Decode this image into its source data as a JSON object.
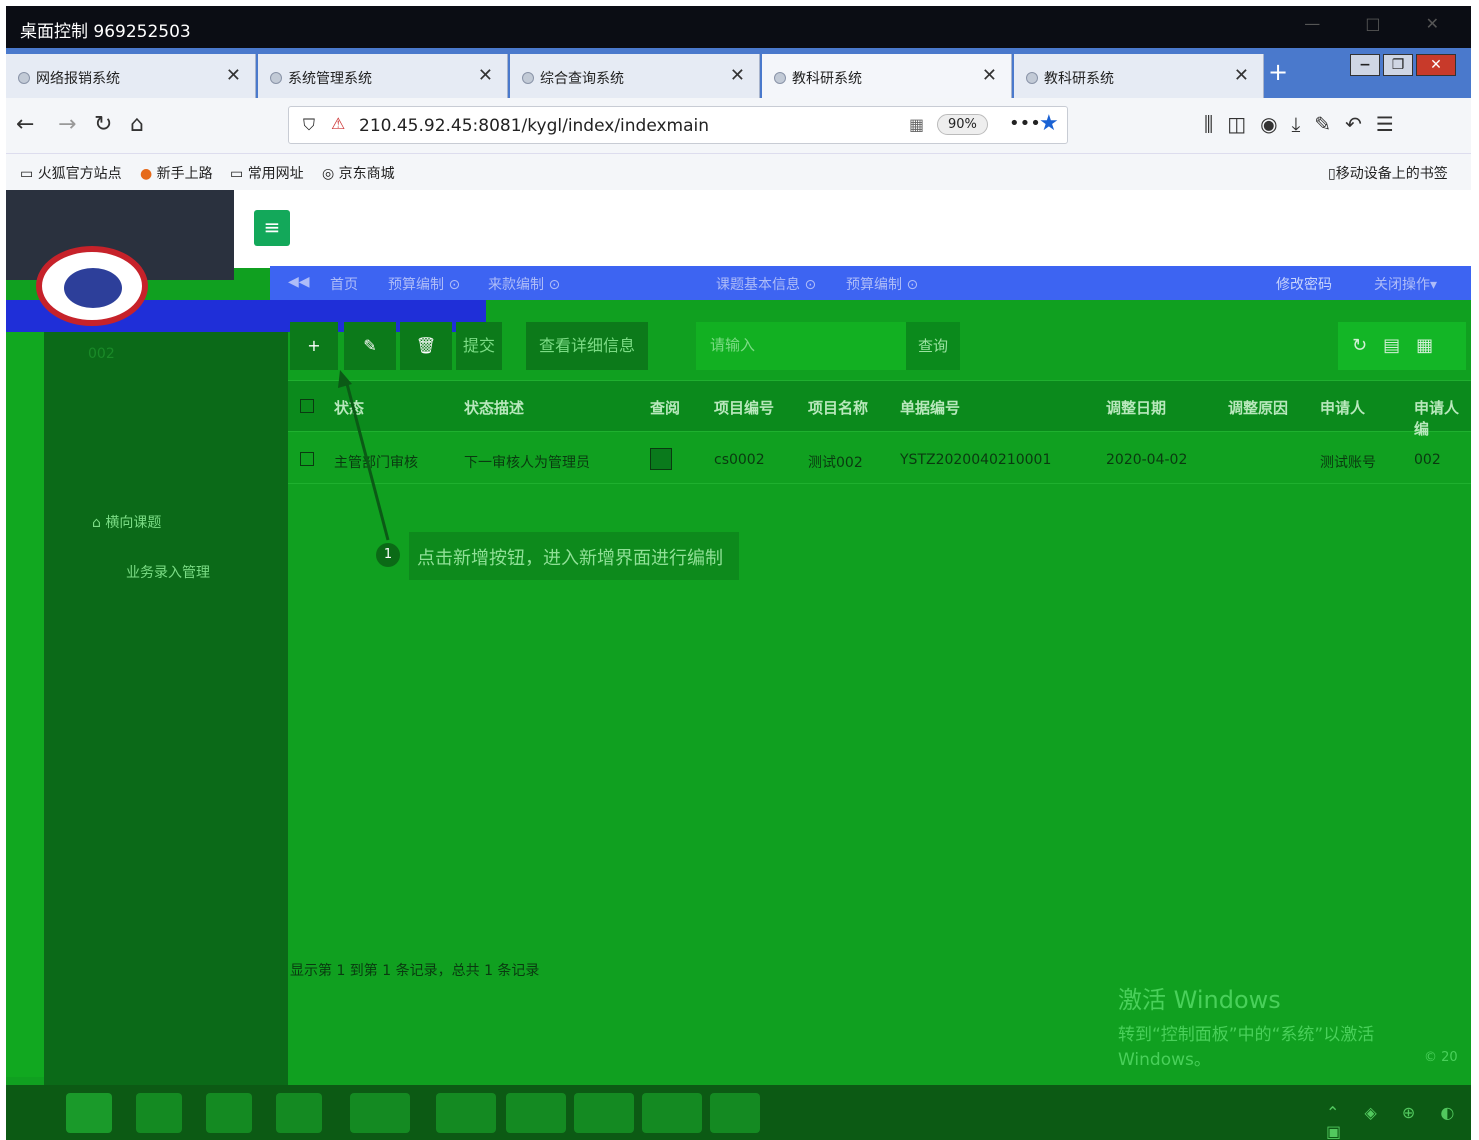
{
  "remote_title": "桌面控制 969252503",
  "tabs": [
    {
      "label": "网络报销系统",
      "active": false
    },
    {
      "label": "系统管理系统",
      "active": false
    },
    {
      "label": "综合查询系统",
      "active": false
    },
    {
      "label": "教科研系统",
      "active": true
    },
    {
      "label": "教科研系统",
      "active": false
    }
  ],
  "url": "210.45.92.45:8081/kygl/index/indexmain",
  "zoom": "90%",
  "bookmarks": [
    "火狐官方站点",
    "新手上路",
    "常用网址",
    "京东商城"
  ],
  "mobile_bookmarks": "移动设备上的书签",
  "page_tabs": [
    "首页",
    "预算编制",
    "来款编制",
    "课题基本信息",
    "预算编制"
  ],
  "change_password": "修改密码",
  "close_ops": "关闭操作",
  "sidebar": {
    "user": "002",
    "section": "横向课题",
    "sub": "业务录入管理"
  },
  "toolbar": {
    "submit": "提交",
    "details": "查看详细信息",
    "search_placeholder": "请输入",
    "query": "查询"
  },
  "table": {
    "headers": [
      "状态",
      "状态描述",
      "查阅",
      "项目编号",
      "项目名称",
      "单据编号",
      "调整日期",
      "调整原因",
      "申请人",
      "申请人编"
    ],
    "rows": [
      {
        "status": "主管部门审核",
        "desc": "下一审核人为管理员",
        "code": "cs0002",
        "name": "测试002",
        "doc": "YSTZ2020040210001",
        "date": "2020-04-02",
        "reason": "",
        "applicant": "测试账号",
        "appid": "002"
      }
    ]
  },
  "annotation": {
    "num": "1",
    "text": "点击新增按钮，进入新增界面进行编制"
  },
  "footer": "显示第 1 到第 1 条记录，总共 1 条记录",
  "activation": {
    "title": "激活 Windows",
    "sub": "转到“控制面板”中的“系统”以激活 Windows。",
    "copy": "© 20"
  }
}
